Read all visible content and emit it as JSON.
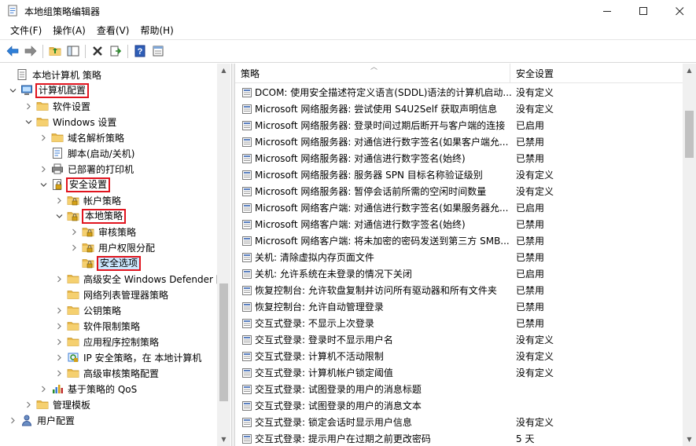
{
  "window": {
    "title": "本地组策略编辑器"
  },
  "menu": [
    {
      "label": "文件(F)"
    },
    {
      "label": "操作(A)"
    },
    {
      "label": "查看(V)"
    },
    {
      "label": "帮助(H)"
    }
  ],
  "colors": {
    "highlight_border": "#e0141e",
    "selection_bg": "#cce8ff",
    "folder": "#e8b84a",
    "accent_blue": "#1e6fc9"
  },
  "tree": [
    {
      "label": "本地计算机 策略",
      "expander": "",
      "icon": "policy-icon"
    },
    {
      "label": "计算机配置",
      "expander": "v",
      "icon": "computer-icon",
      "highlight": true
    },
    {
      "label": "软件设置",
      "expander": ">",
      "icon": "folder-icon"
    },
    {
      "label": "Windows 设置",
      "expander": "v",
      "icon": "folder-icon"
    },
    {
      "label": "域名解析策略",
      "expander": ">",
      "icon": "folder-icon"
    },
    {
      "label": "脚本(启动/关机)",
      "expander": "",
      "icon": "script-icon"
    },
    {
      "label": "已部署的打印机",
      "expander": ">",
      "icon": "printer-icon"
    },
    {
      "label": "安全设置",
      "expander": "v",
      "icon": "security-icon",
      "highlight": true
    },
    {
      "label": "帐户策略",
      "expander": ">",
      "icon": "locked-folder-icon"
    },
    {
      "label": "本地策略",
      "expander": "v",
      "icon": "locked-folder-icon",
      "highlight": true
    },
    {
      "label": "审核策略",
      "expander": ">",
      "icon": "locked-folder-icon"
    },
    {
      "label": "用户权限分配",
      "expander": ">",
      "icon": "locked-folder-icon"
    },
    {
      "label": "安全选项",
      "expander": "",
      "icon": "locked-folder-icon",
      "selected": true
    },
    {
      "label": "高级安全 Windows Defender 防",
      "expander": ">",
      "icon": "folder-icon"
    },
    {
      "label": "网络列表管理器策略",
      "expander": "",
      "icon": "folder-icon"
    },
    {
      "label": "公钥策略",
      "expander": ">",
      "icon": "folder-icon"
    },
    {
      "label": "软件限制策略",
      "expander": ">",
      "icon": "folder-icon"
    },
    {
      "label": "应用程序控制策略",
      "expander": ">",
      "icon": "folder-icon"
    },
    {
      "label": "IP 安全策略，在 本地计算机",
      "expander": ">",
      "icon": "ip-security-icon"
    },
    {
      "label": "高级审核策略配置",
      "expander": ">",
      "icon": "folder-icon"
    },
    {
      "label": "基于策略的 QoS",
      "expander": ">",
      "icon": "qos-chart-icon"
    },
    {
      "label": "管理模板",
      "expander": ">",
      "icon": "folder-icon"
    },
    {
      "label": "用户配置",
      "expander": ">",
      "icon": "user-icon"
    }
  ],
  "list": {
    "col_policy": "策略",
    "col_setting": "安全设置",
    "rows": [
      {
        "policy": "DCOM: 使用安全描述符定义语言(SDDL)语法的计算机启动...",
        "setting": "没有定义"
      },
      {
        "policy": "Microsoft 网络服务器: 尝试使用 S4U2Self 获取声明信息",
        "setting": "没有定义"
      },
      {
        "policy": "Microsoft 网络服务器: 登录时间过期后断开与客户端的连接",
        "setting": "已启用"
      },
      {
        "policy": "Microsoft 网络服务器: 对通信进行数字签名(如果客户端允...",
        "setting": "已禁用"
      },
      {
        "policy": "Microsoft 网络服务器: 对通信进行数字签名(始终)",
        "setting": "已禁用"
      },
      {
        "policy": "Microsoft 网络服务器: 服务器 SPN 目标名称验证级别",
        "setting": "没有定义"
      },
      {
        "policy": "Microsoft 网络服务器: 暂停会话前所需的空闲时间数量",
        "setting": "没有定义"
      },
      {
        "policy": "Microsoft 网络客户端: 对通信进行数字签名(如果服务器允...",
        "setting": "已启用"
      },
      {
        "policy": "Microsoft 网络客户端: 对通信进行数字签名(始终)",
        "setting": "已禁用"
      },
      {
        "policy": "Microsoft 网络客户端: 将未加密的密码发送到第三方 SMB...",
        "setting": "已禁用"
      },
      {
        "policy": "关机: 清除虚拟内存页面文件",
        "setting": "已禁用"
      },
      {
        "policy": "关机: 允许系统在未登录的情况下关闭",
        "setting": "已启用"
      },
      {
        "policy": "恢复控制台: 允许软盘复制并访问所有驱动器和所有文件夹",
        "setting": "已禁用"
      },
      {
        "policy": "恢复控制台: 允许自动管理登录",
        "setting": "已禁用"
      },
      {
        "policy": "交互式登录: 不显示上次登录",
        "setting": "已禁用"
      },
      {
        "policy": "交互式登录: 登录时不显示用户名",
        "setting": "没有定义"
      },
      {
        "policy": "交互式登录: 计算机不活动限制",
        "setting": "没有定义"
      },
      {
        "policy": "交互式登录: 计算机帐户锁定阈值",
        "setting": "没有定义"
      },
      {
        "policy": "交互式登录: 试图登录的用户的消息标题",
        "setting": ""
      },
      {
        "policy": "交互式登录: 试图登录的用户的消息文本",
        "setting": ""
      },
      {
        "policy": "交互式登录: 锁定会话时显示用户信息",
        "setting": "没有定义"
      },
      {
        "policy": "交互式登录: 提示用户在过期之前更改密码",
        "setting": "5 天"
      }
    ]
  }
}
